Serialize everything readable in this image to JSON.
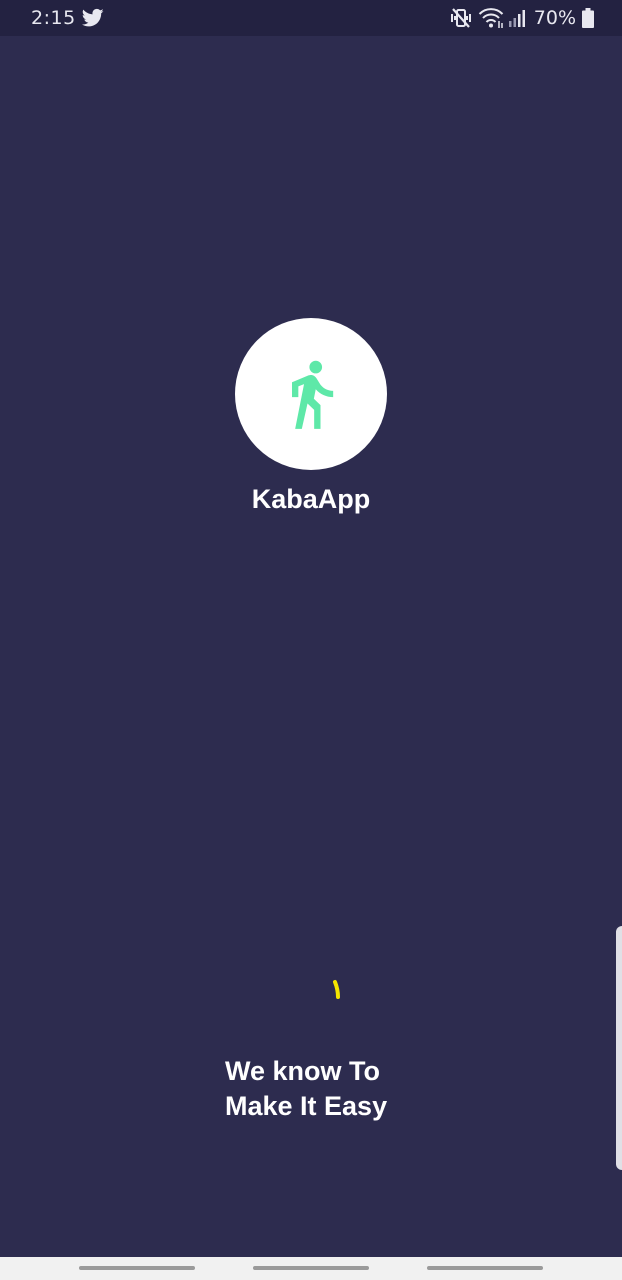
{
  "status_bar": {
    "time": "2:15",
    "battery": "70%",
    "icons": [
      "twitter-icon",
      "mute-vibrate-icon",
      "wifi-icon",
      "signal-icon",
      "battery-icon"
    ]
  },
  "splash": {
    "logo_icon": "walking-person-icon",
    "app_name": "KabaApp",
    "tagline_line1": "We know To",
    "tagline_line2": "Make It Easy"
  },
  "colors": {
    "background": "#2d2c4f",
    "status_bar": "#232241",
    "logo_background": "#ffffff",
    "logo_icon": "#5ee8a8",
    "loading_indicator": "#f5e600",
    "text": "#ffffff"
  },
  "nav_bar": {
    "buttons": [
      "recent-apps-button",
      "home-button",
      "back-button"
    ]
  }
}
